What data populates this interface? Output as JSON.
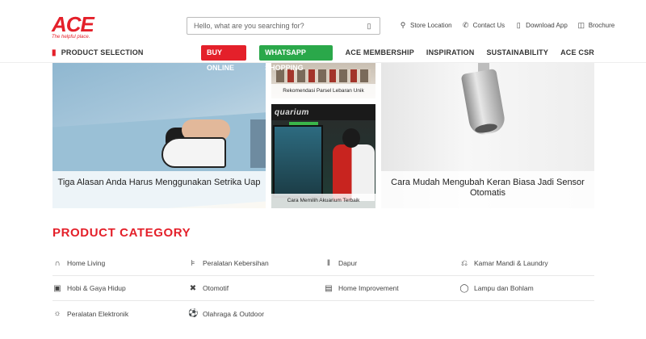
{
  "header": {
    "logo_main": "ACE",
    "logo_tag": "The helpful place.",
    "search_placeholder": "Hello, what are you searching for?",
    "top_links": [
      {
        "label": "Store Location",
        "icon": "map-pin-icon"
      },
      {
        "label": "Contact Us",
        "icon": "phone-icon"
      },
      {
        "label": "Download App",
        "icon": "mobile-icon"
      },
      {
        "label": "Brochure",
        "icon": "book-icon"
      }
    ]
  },
  "nav": {
    "product_selection": "PRODUCT SELECTION",
    "buy_online": "BUY ONLINE",
    "whatsapp": "WHATSAPP SHOPPING",
    "links": [
      "ACE MEMBERSHIP",
      "INSPIRATION",
      "SUSTAINABILITY",
      "ACE CSR"
    ]
  },
  "banners": {
    "iron_caption": "Tiga Alasan Anda Harus Menggunakan Setrika Uap",
    "parcel_caption": "Rekomendasi Parsel Lebaran Unik",
    "aquarium_sign": "quarium",
    "aquarium_caption": "Cara Memilih Akuarium Terbaik",
    "faucet_caption": "Cara Mudah Mengubah Keran Biasa Jadi Sensor Otomatis"
  },
  "category": {
    "title": "PRODUCT CATEGORY",
    "items": [
      {
        "label": "Home Living",
        "icon": "bed-icon"
      },
      {
        "label": "Peralatan Kebersihan",
        "icon": "broom-icon"
      },
      {
        "label": "Dapur",
        "icon": "kitchen-icon"
      },
      {
        "label": "Kamar Mandi & Laundry",
        "icon": "bathtub-icon"
      },
      {
        "label": "Hobi & Gaya Hidup",
        "icon": "shirt-icon"
      },
      {
        "label": "Otomotif",
        "icon": "tools-icon"
      },
      {
        "label": "Home Improvement",
        "icon": "door-icon"
      },
      {
        "label": "Lampu dan Bohlam",
        "icon": "bulb-icon"
      },
      {
        "label": "Peralatan Elektronik",
        "icon": "plug-icon"
      },
      {
        "label": "Olahraga & Outdoor",
        "icon": "ball-icon"
      }
    ]
  }
}
